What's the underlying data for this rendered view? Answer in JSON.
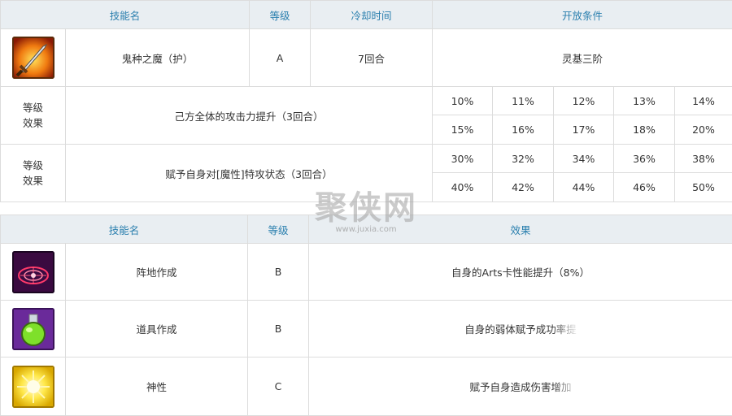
{
  "table1": {
    "headers": [
      "技能名",
      "等级",
      "冷却时间",
      "开放条件"
    ],
    "skill": {
      "icon": "sword-icon",
      "name": "鬼种之魔（护）",
      "rank": "A",
      "cooldown": "7回合",
      "unlock": "灵基三阶"
    },
    "effects": [
      {
        "label": "等级\n效果",
        "desc": "己方全体的攻击力提升（3回合）",
        "row1": [
          "10%",
          "11%",
          "12%",
          "13%",
          "14%"
        ],
        "row2": [
          "15%",
          "16%",
          "17%",
          "18%",
          "20%"
        ]
      },
      {
        "label": "等级\n效果",
        "desc": "赋予自身对[魔性]特攻状态（3回合）",
        "row1": [
          "30%",
          "32%",
          "34%",
          "36%",
          "38%"
        ],
        "row2": [
          "40%",
          "42%",
          "44%",
          "46%",
          "50%"
        ]
      }
    ]
  },
  "table2": {
    "headers": [
      "技能名",
      "等级",
      "效果"
    ],
    "rows": [
      {
        "icon": "magic-circle-icon",
        "name": "阵地作成",
        "rank": "B",
        "effect": "自身的Arts卡性能提升（8%）"
      },
      {
        "icon": "potion-flask-icon",
        "name": "道具作成",
        "rank": "B",
        "effect": "自身的弱体赋予成功率提"
      },
      {
        "icon": "divinity-sun-icon",
        "name": "神性",
        "rank": "C",
        "effect": "赋予自身造成伤害增加"
      }
    ]
  },
  "watermark": {
    "text": "聚侠网",
    "url": "www.juxia.com"
  }
}
